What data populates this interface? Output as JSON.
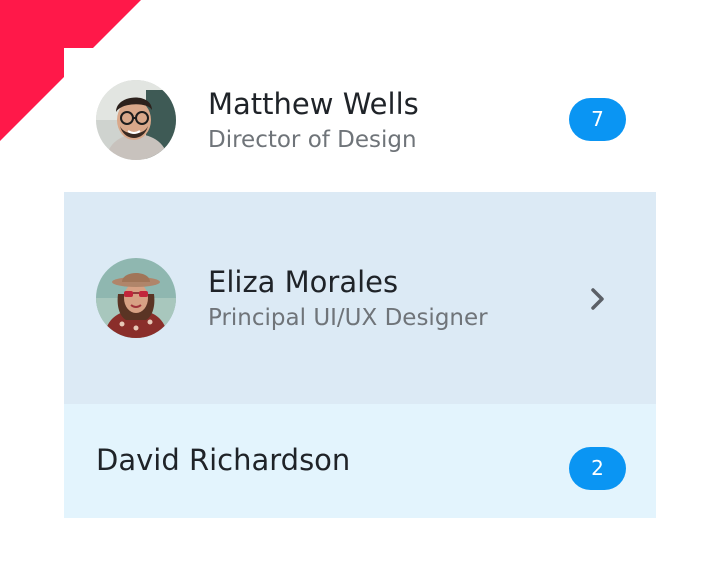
{
  "colors": {
    "accent": "#0a95f3",
    "corner": "#ff1849",
    "selected_row": "#dceaf5",
    "highlight_row": "#e3f4fd"
  },
  "contacts": [
    {
      "name": "Matthew Wells",
      "title": "Director of Design",
      "badge": "7",
      "avatar": "avatar-photo"
    },
    {
      "name": "Eliza Morales",
      "title": "Principal UI/UX Designer",
      "trailing_icon": "chevron-right-icon",
      "avatar": "avatar-photo"
    },
    {
      "name": "David Richardson",
      "badge": "2"
    }
  ]
}
